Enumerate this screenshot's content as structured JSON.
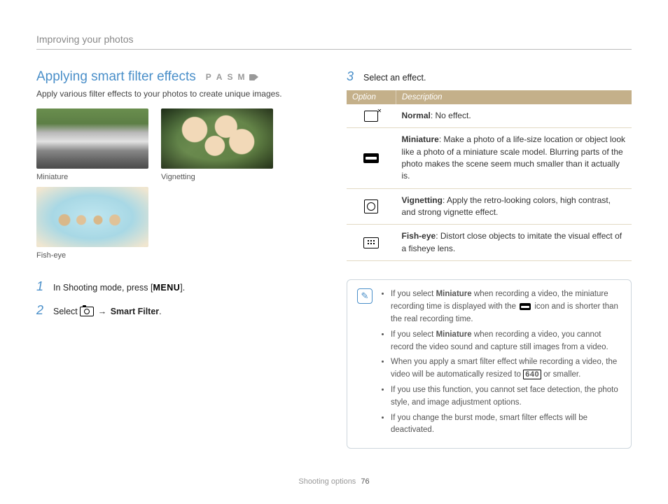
{
  "header": {
    "breadcrumb": "Improving your photos"
  },
  "title": "Applying smart filter effects",
  "modes": [
    "P",
    "A",
    "S",
    "M"
  ],
  "intro": "Apply various filter effects to your photos to create unique images.",
  "thumbs": {
    "miniature": "Miniature",
    "vignetting": "Vignetting",
    "fisheye": "Fish-eye"
  },
  "steps": {
    "s1": {
      "num": "1",
      "pre": "In Shooting mode, press [",
      "menu": "MENU",
      "post": "]."
    },
    "s2": {
      "num": "2",
      "pre": "Select ",
      "arrow": "→",
      "bold": "Smart Filter",
      "post": "."
    },
    "s3": {
      "num": "3",
      "text": "Select an effect."
    }
  },
  "table": {
    "h_option": "Option",
    "h_desc": "Description",
    "rows": {
      "normal": {
        "name": "Normal",
        "desc": ": No effect."
      },
      "mini": {
        "name": "Miniature",
        "desc": ": Make a photo of a life-size location or object look like a photo of a miniature scale model. Blurring parts of the photo makes the scene seem much smaller than it actually is."
      },
      "vig": {
        "name": "Vignetting",
        "desc": ": Apply the retro-looking colors, high contrast, and strong vignette effect."
      },
      "fish": {
        "name": "Fish-eye",
        "desc": ": Distort close objects to imitate the visual effect of a fisheye lens."
      }
    }
  },
  "notes": {
    "n1a": "If you select ",
    "n1b": "Miniature",
    "n1c": " when recording a video, the miniature recording time is displayed with the ",
    "n1d": " icon and is shorter than the real recording time.",
    "n2a": "If you select ",
    "n2b": "Miniature",
    "n2c": " when recording a video, you cannot record the video sound and capture still images from a video.",
    "n3a": "When you apply a smart filter effect while recording a video, the video will be automatically resized to ",
    "n3b": "640",
    "n3c": " or smaller.",
    "n4": "If you use this function, you cannot set face detection, the photo style, and image adjustment options.",
    "n5": "If you change the burst mode, smart filter effects will be deactivated."
  },
  "footer": {
    "section": "Shooting options",
    "page": "76"
  }
}
